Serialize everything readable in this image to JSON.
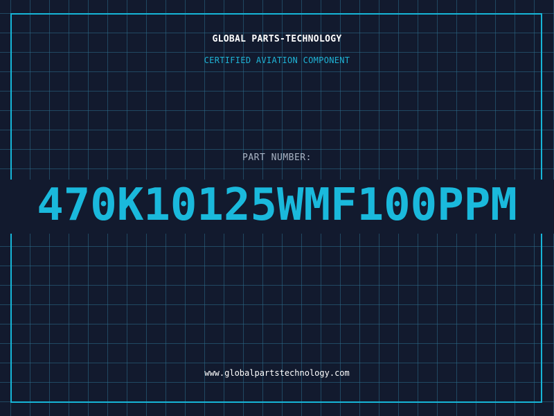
{
  "header": {
    "company": "GLOBAL PARTS-TECHNOLOGY",
    "subtitle": "CERTIFIED AVIATION COMPONENT"
  },
  "part": {
    "label": "PART NUMBER:",
    "number": "470K10125WMF100PPM"
  },
  "footer": {
    "url": "www.globalpartstechnology.com"
  },
  "colors": {
    "background": "#121a2e",
    "grid": "#2d6e8c",
    "accent": "#16b6d8",
    "text": "#ffffff",
    "label": "#aab4c4"
  }
}
